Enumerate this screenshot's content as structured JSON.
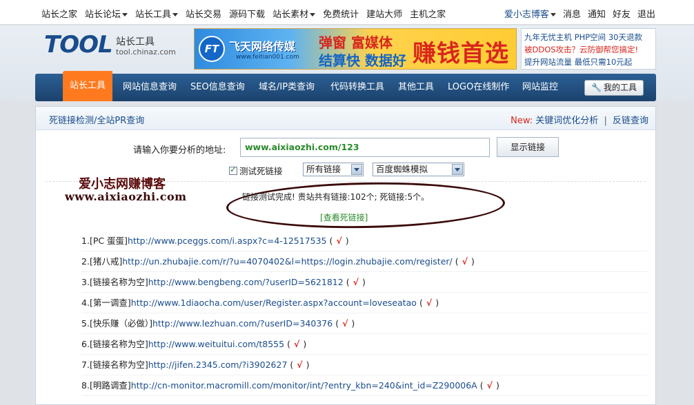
{
  "topnav": {
    "items": [
      {
        "label": "站长之家",
        "dropdown": false
      },
      {
        "label": "站长论坛",
        "dropdown": true
      },
      {
        "label": "站长工具",
        "dropdown": true
      },
      {
        "label": "站长交易",
        "dropdown": false
      },
      {
        "label": "源码下载",
        "dropdown": false
      },
      {
        "label": "站长素材",
        "dropdown": true
      },
      {
        "label": "免费统计",
        "dropdown": false
      },
      {
        "label": "建站大师",
        "dropdown": false
      },
      {
        "label": "主机之家",
        "dropdown": false
      }
    ],
    "user": "爱小志博客",
    "right_links": [
      "消息",
      "通知",
      "好友",
      "退出"
    ]
  },
  "logo": {
    "text": "TOOL",
    "cn": "站长工具",
    "domain": "tool.chinaz.com"
  },
  "banner": {
    "brand_mark": "FT",
    "brand": "飞天网络传媒",
    "site": "www.feitian001.com",
    "line1": "弹窗 富媒体",
    "line2": "结算快 数据好",
    "slogan": "赚钱首选"
  },
  "promo": {
    "line1": "九年无忧主机 PHP空间 30天退款",
    "line2": "被DDOS攻击？云防御帮您搞定!",
    "line3": "提升网站流量 最低只需10元起"
  },
  "mainnav": {
    "items": [
      "站长工具",
      "网站信息查询",
      "SEO信息查询",
      "域名/IP类查询",
      "代码转换工具",
      "其他工具",
      "LOGO在线制作",
      "网站监控"
    ],
    "active_index": 0,
    "my_tools": "我的工具"
  },
  "crumb": {
    "title": "死链接检测/全站PR查询",
    "new_label": "New:",
    "link1": "关键词优化分析",
    "separator": "|",
    "link2": "反链查询"
  },
  "form": {
    "label": "请输入你要分析的地址:",
    "url": "www.aixiaozhi.com/123",
    "button": "显示链接",
    "checkbox_label": "测试死链接",
    "checkbox_checked": true,
    "select_links": "所有链接",
    "select_spider": "百度蜘蛛模拟"
  },
  "watermark": {
    "line1": "爱小志网赚博客",
    "line2": "www.aixiaozhi.com"
  },
  "result": {
    "summary": "链接测试完成! 贵站共有链接:102个; 死链接:5个。",
    "view_dead": "[查看死链接]"
  },
  "links": [
    {
      "num": "1.",
      "name": "[PC 蛋蛋]",
      "url": "http://www.pceggs.com/i.aspx?c=4-12517535",
      "status": "√"
    },
    {
      "num": "2.",
      "name": "[猪八戒]",
      "url": "http://un.zhubajie.com/r/?u=4070402&l=https://login.zhubajie.com/register/",
      "status": "√"
    },
    {
      "num": "3.",
      "name": "[链接名称为空]",
      "url": "http://www.bengbeng.com/?userID=5621812",
      "status": "√"
    },
    {
      "num": "4.",
      "name": "[第一调查]",
      "url": "http://www.1diaocha.com/user/Register.aspx?account=loveseatao",
      "status": "√"
    },
    {
      "num": "5.",
      "name": "[快乐赚（必做）]",
      "url": "http://www.lezhuan.com/?userID=340376",
      "status": "√"
    },
    {
      "num": "6.",
      "name": "[链接名称为空]",
      "url": "http://www.weituitui.com/t8555",
      "status": "√"
    },
    {
      "num": "7.",
      "name": "[链接名称为空]",
      "url": "http://jifen.2345.com/?i3902627",
      "status": "√"
    },
    {
      "num": "8.",
      "name": "[明路调查]",
      "url": "http://cn-monitor.macromill.com/monitor/int/?entry_kbn=240&int_id=Z290006A",
      "status": "√"
    }
  ]
}
